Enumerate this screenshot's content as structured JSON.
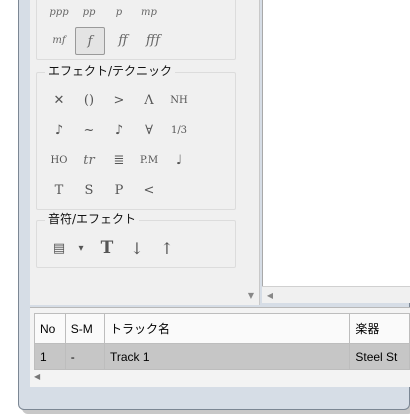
{
  "dynamics": {
    "row1": [
      "ppp",
      "pp",
      "p",
      "mp"
    ],
    "row2": [
      "mf",
      "f",
      "ff",
      "fff"
    ],
    "selected": "f"
  },
  "effects_group": {
    "title": "エフェクト/テクニック",
    "row1": [
      "✕",
      "()",
      ">",
      "Λ",
      "NH"
    ],
    "row2": [
      "♪",
      "~",
      "♪",
      "∀",
      "1/3"
    ],
    "row3": [
      "HO",
      "tr",
      "≣",
      "P.M",
      "♩"
    ],
    "row4": [
      "T",
      "S",
      "P",
      "<"
    ]
  },
  "notes_group": {
    "title": "音符/エフェクト",
    "row1": [
      "▤",
      "▾",
      "T",
      "↓",
      "↑"
    ]
  },
  "track_table": {
    "headers": [
      "No",
      "S-M",
      "トラック名",
      "楽器"
    ],
    "rows": [
      [
        "1",
        "-",
        "Track 1",
        "Steel St"
      ]
    ]
  },
  "icons": {
    "scroll_down": "down-arrow-icon",
    "scroll_left": "left-arrow-icon"
  }
}
